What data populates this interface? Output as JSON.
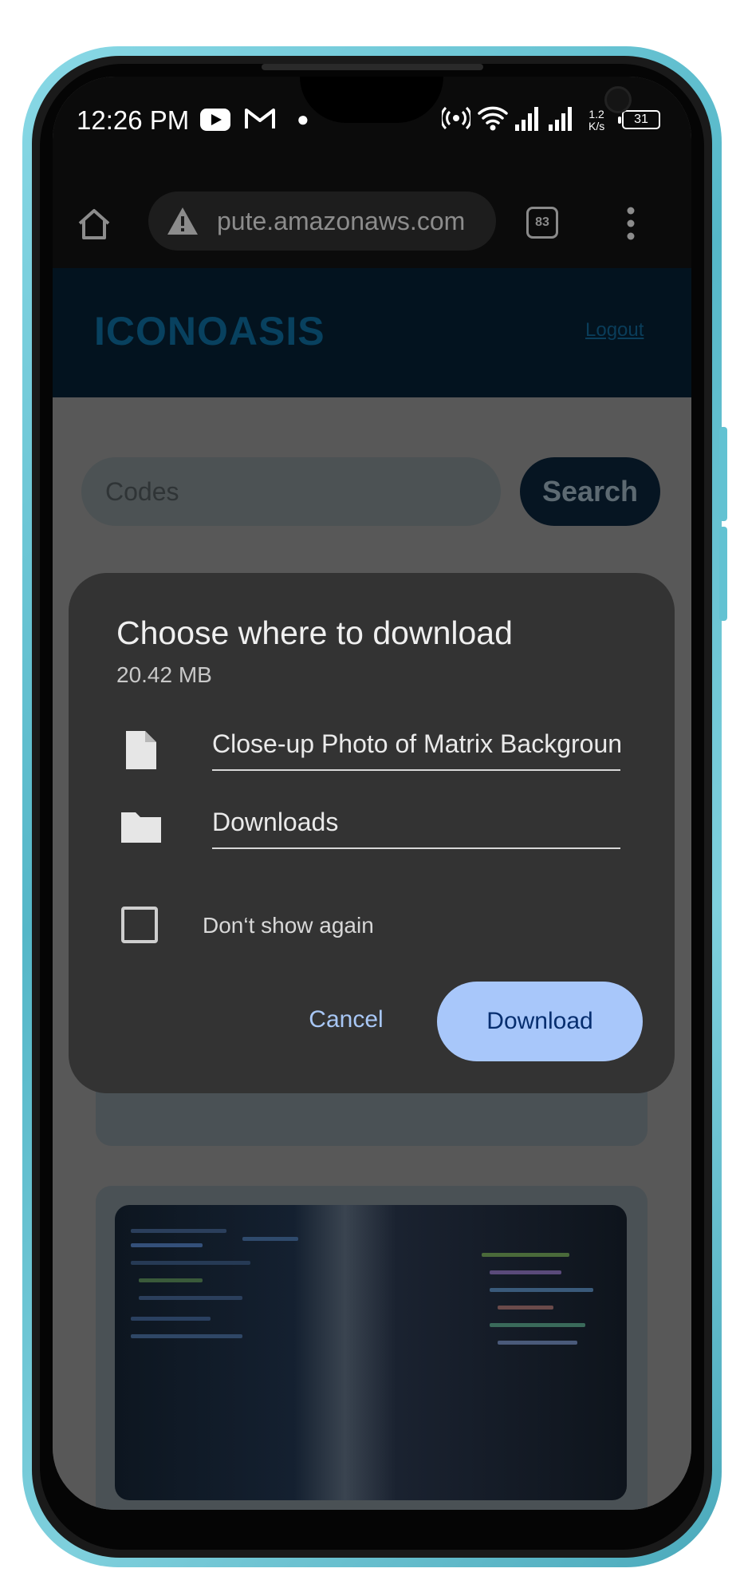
{
  "status_bar": {
    "time": "12:26 PM",
    "speed": "1.2\nK/s",
    "speed_top": "1.2",
    "speed_bottom": "K/s",
    "battery": "31",
    "icons": [
      "youtube-icon",
      "gmail-icon",
      "dot-icon",
      "hotspot-icon",
      "wifi-icon",
      "signal-icon",
      "battery-icon"
    ]
  },
  "browser": {
    "url": "pute.amazonaws.com",
    "tab_count": "83",
    "icons": [
      "home-icon",
      "warning-icon",
      "menu-icon"
    ]
  },
  "site": {
    "logo": "ICONOASIS",
    "logout": "Logout",
    "search_value": "Codes",
    "search_button": "Search"
  },
  "dialog": {
    "title": "Choose where to download",
    "size": "20.42 MB",
    "filename": "Close-up Photo of Matrix Background",
    "location": "Downloads",
    "dont_show_label": "Don‘t show again",
    "dont_show_checked": false,
    "cancel_label": "Cancel",
    "download_label": "Download"
  },
  "colors": {
    "frame": "#55b7c8",
    "dialog_bg": "#333333",
    "download_button": "#a8c7fa",
    "cancel_text": "#a8c7f5"
  }
}
